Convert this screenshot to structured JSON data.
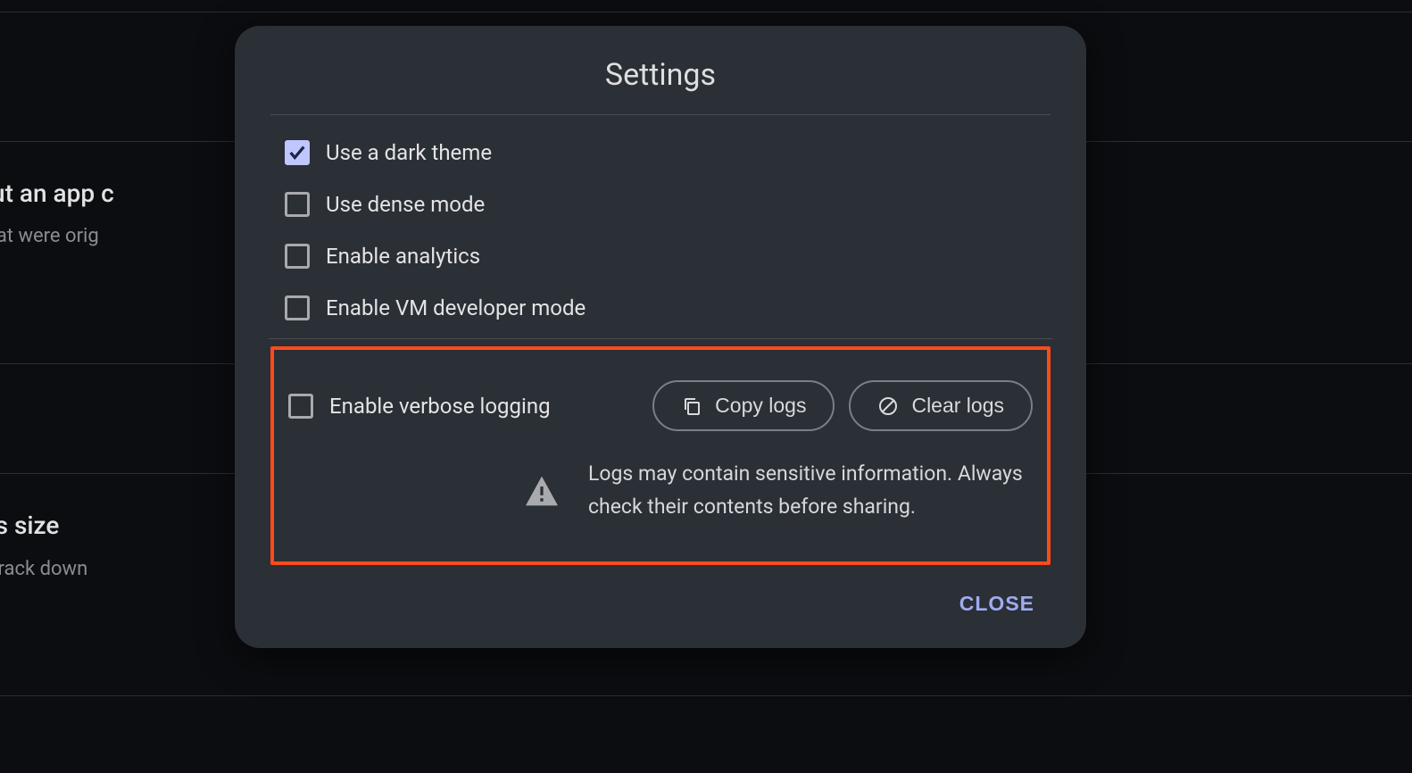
{
  "background": {
    "heading1": "s without an app c",
    "sub1": "rting files that were orig",
    "heading2": "pp's size",
    "sub2": "lysis files to track down"
  },
  "dialog": {
    "title": "Settings",
    "options": {
      "darkTheme": {
        "label": "Use a dark theme",
        "checked": true
      },
      "denseMode": {
        "label": "Use dense mode",
        "checked": false
      },
      "analytics": {
        "label": "Enable analytics",
        "checked": false
      },
      "vmDev": {
        "label": "Enable VM developer mode",
        "checked": false
      },
      "verboseLogging": {
        "label": "Enable verbose logging",
        "checked": false
      }
    },
    "buttons": {
      "copyLogs": "Copy logs",
      "clearLogs": "Clear logs",
      "close": "CLOSE"
    },
    "warning": "Logs may contain sensitive information. Always check their contents before sharing."
  }
}
